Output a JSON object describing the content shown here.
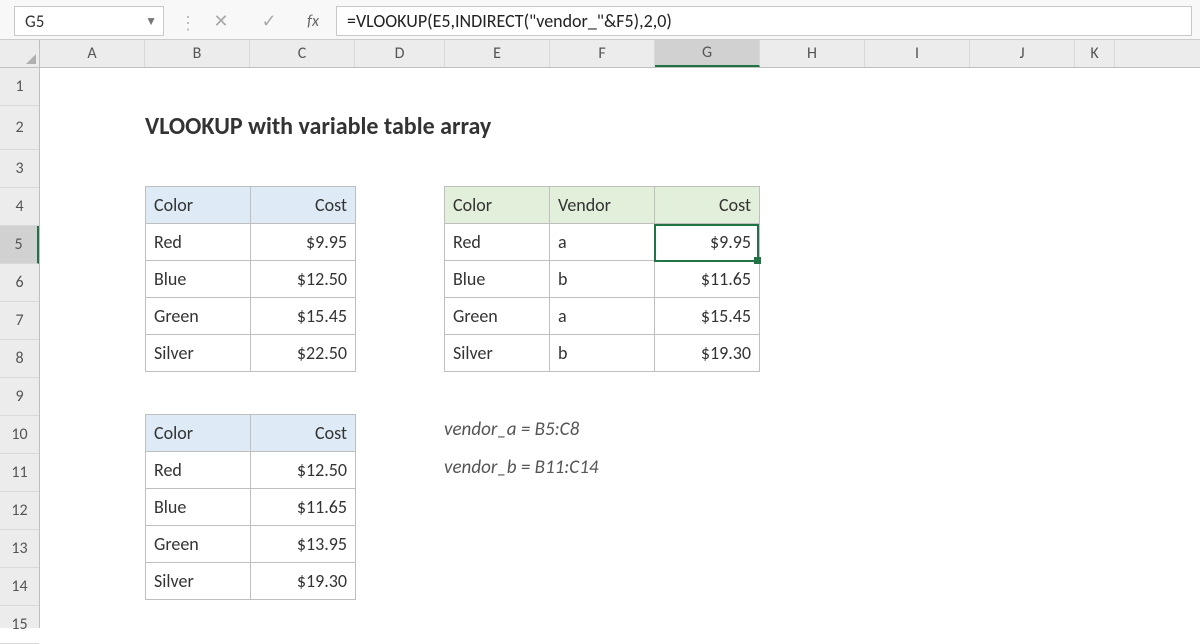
{
  "namebox": {
    "value": "G5"
  },
  "formula": "=VLOOKUP(E5,INDIRECT(\"vendor_\"&F5),2,0)",
  "columns": [
    "A",
    "B",
    "C",
    "D",
    "E",
    "F",
    "G",
    "H",
    "I",
    "J",
    "K"
  ],
  "selected_col": "G",
  "rows": [
    "1",
    "2",
    "3",
    "4",
    "5",
    "6",
    "7",
    "8",
    "9",
    "10",
    "11",
    "12",
    "13",
    "14",
    "15"
  ],
  "selected_row": "5",
  "title": "VLOOKUP with variable table array",
  "table_a": {
    "headers": {
      "color": "Color",
      "cost": "Cost"
    },
    "rows": [
      {
        "color": "Red",
        "cost": "$9.95"
      },
      {
        "color": "Blue",
        "cost": "$12.50"
      },
      {
        "color": "Green",
        "cost": "$15.45"
      },
      {
        "color": "Silver",
        "cost": "$22.50"
      }
    ]
  },
  "table_b": {
    "headers": {
      "color": "Color",
      "cost": "Cost"
    },
    "rows": [
      {
        "color": "Red",
        "cost": "$12.50"
      },
      {
        "color": "Blue",
        "cost": "$11.65"
      },
      {
        "color": "Green",
        "cost": "$13.95"
      },
      {
        "color": "Silver",
        "cost": "$19.30"
      }
    ]
  },
  "table_c": {
    "headers": {
      "color": "Color",
      "vendor": "Vendor",
      "cost": "Cost"
    },
    "rows": [
      {
        "color": "Red",
        "vendor": "a",
        "cost": "$9.95"
      },
      {
        "color": "Blue",
        "vendor": "b",
        "cost": "$11.65"
      },
      {
        "color": "Green",
        "vendor": "a",
        "cost": "$15.45"
      },
      {
        "color": "Silver",
        "vendor": "b",
        "cost": "$19.30"
      }
    ]
  },
  "notes": {
    "a": "vendor_a = B5:C8",
    "b": "vendor_b = B11:C14"
  }
}
